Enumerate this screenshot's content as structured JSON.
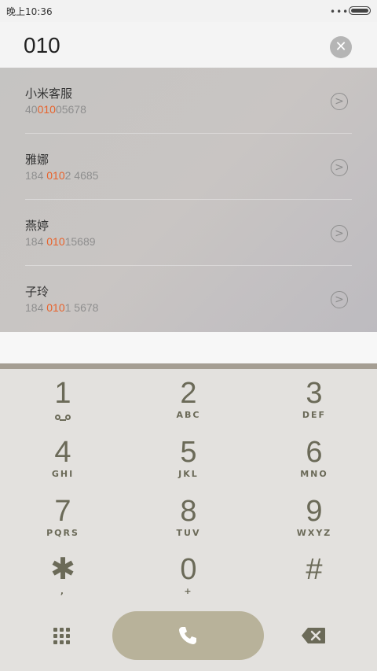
{
  "status_bar": {
    "time": "晚上10:36",
    "dots": "•••"
  },
  "dialer": {
    "entered_number": "010",
    "clear_symbol": "✕"
  },
  "results": [
    {
      "name": "小米客服",
      "number_pre": "40",
      "number_match": "010",
      "number_post": "05678"
    },
    {
      "name": "雅娜",
      "number_pre": "184 ",
      "number_match": "010",
      "number_post": "2 4685"
    },
    {
      "name": "燕婷",
      "number_pre": "184 ",
      "number_match": "010",
      "number_post": "15689"
    },
    {
      "name": "子玲",
      "number_pre": "184 ",
      "number_match": "010",
      "number_post": "1 5678"
    }
  ],
  "arrow_symbol": ">",
  "keypad": {
    "k1": {
      "digit": "1",
      "letters": ""
    },
    "k2": {
      "digit": "2",
      "letters": "ABC"
    },
    "k3": {
      "digit": "3",
      "letters": "DEF"
    },
    "k4": {
      "digit": "4",
      "letters": "GHI"
    },
    "k5": {
      "digit": "5",
      "letters": "JKL"
    },
    "k6": {
      "digit": "6",
      "letters": "MNO"
    },
    "k7": {
      "digit": "7",
      "letters": "PQRS"
    },
    "k8": {
      "digit": "8",
      "letters": "TUV"
    },
    "k9": {
      "digit": "9",
      "letters": "WXYZ"
    },
    "kstar": {
      "digit": "✱",
      "letters": ","
    },
    "k0": {
      "digit": "0",
      "letters": "+"
    },
    "khash": {
      "digit": "#",
      "letters": ""
    }
  },
  "colors": {
    "match": "#e8622b",
    "keypad_text": "#6b6a58",
    "call_button": "#b8b29a"
  },
  "icons": {
    "voicemail": "voicemail-icon",
    "dialpad": "dialpad-icon",
    "call": "phone-icon",
    "delete": "backspace-icon"
  }
}
